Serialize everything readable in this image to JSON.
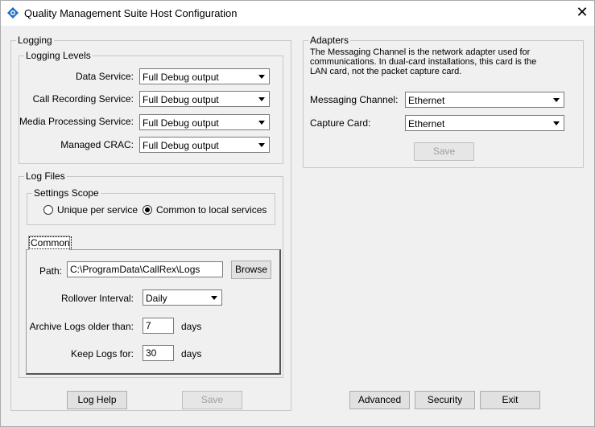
{
  "window": {
    "title": "Quality Management Suite Host Configuration"
  },
  "logging": {
    "group_label": "Logging",
    "levels": {
      "group_label": "Logging Levels",
      "rows": [
        {
          "label": "Data Service:",
          "value": "Full Debug output"
        },
        {
          "label": "Call Recording Service:",
          "value": "Full Debug output"
        },
        {
          "label": "Media Processing Service:",
          "value": "Full Debug output"
        },
        {
          "label": "Managed CRAC:",
          "value": "Full Debug output"
        }
      ]
    },
    "log_files": {
      "group_label": "Log Files",
      "scope": {
        "group_label": "Settings Scope",
        "option_unique": "Unique per service",
        "option_common": "Common to local services",
        "selected": "common"
      },
      "tab_label": "Common",
      "path_label": "Path:",
      "path_value": "C:\\ProgramData\\CallRex\\Logs",
      "browse_label": "Browse",
      "rollover_label": "Rollover Interval:",
      "rollover_value": "Daily",
      "archive_label": "Archive Logs older than:",
      "archive_value": "7",
      "archive_unit": "days",
      "keep_label": "Keep Logs for:",
      "keep_value": "30",
      "keep_unit": "days"
    },
    "log_help_label": "Log Help",
    "save_label": "Save"
  },
  "adapters": {
    "group_label": "Adapters",
    "description": "The Messaging Channel is the network adapter used for communications.  In dual-card installations, this card is the LAN card, not the packet capture card.",
    "messaging_label": "Messaging Channel:",
    "messaging_value": "Ethernet",
    "capture_label": "Capture Card:",
    "capture_value": "Ethernet",
    "save_label": "Save"
  },
  "footer": {
    "advanced_label": "Advanced",
    "security_label": "Security",
    "exit_label": "Exit"
  }
}
